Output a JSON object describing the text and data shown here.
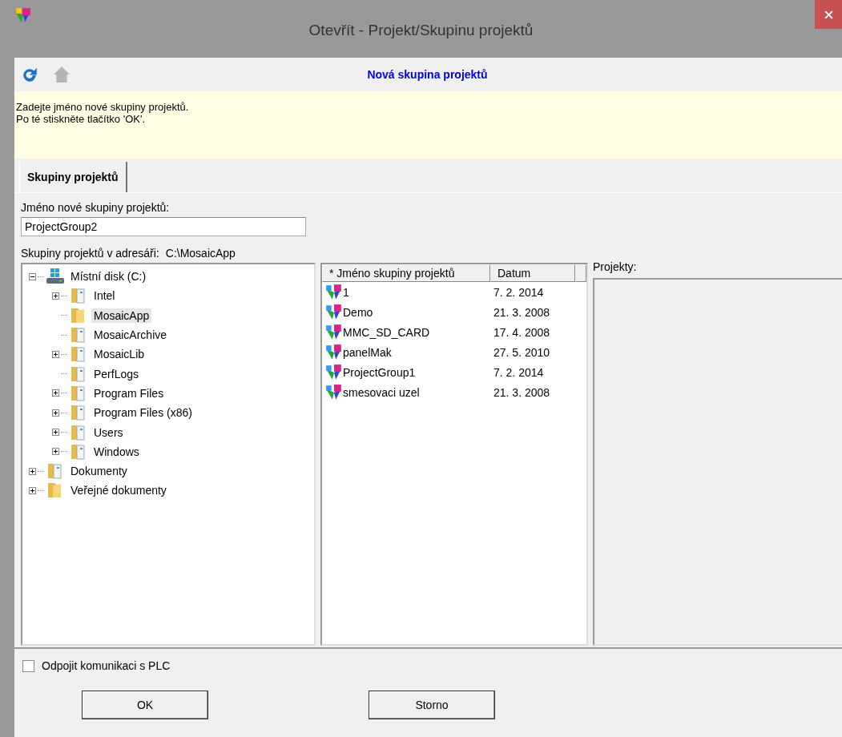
{
  "window": {
    "title": "Otevřít - Projekt/Skupinu projektů"
  },
  "toolbar": {
    "home_disabled": true,
    "heading": "Nová skupina projektů"
  },
  "hint": {
    "lines": [
      "Zadejte jméno nové skupiny projektů.",
      "Po té stiskněte tlačítko 'OK'."
    ]
  },
  "tabs": [
    {
      "label": "Skupiny projektů",
      "selected": true
    }
  ],
  "name_field": {
    "label": "Jméno nové skupiny projektů:",
    "value": "ProjectGroup2"
  },
  "directory": {
    "label": "Skupiny projektů v adresáři:",
    "path": "C:\\MosaicApp"
  },
  "tree": [
    {
      "label": "Místní disk (C:)",
      "kind": "drive",
      "expanded": true,
      "selected": false,
      "children": [
        {
          "label": "Intel",
          "kind": "folder-docs",
          "expanded": false,
          "selected": false
        },
        {
          "label": "MosaicApp",
          "kind": "folder",
          "selected": true
        },
        {
          "label": "MosaicArchive",
          "kind": "folder-docs",
          "selected": false
        },
        {
          "label": "MosaicLib",
          "kind": "folder-docs",
          "expanded": false,
          "selected": false
        },
        {
          "label": "PerfLogs",
          "kind": "folder-docs",
          "selected": false
        },
        {
          "label": "Program Files",
          "kind": "folder-docs",
          "expanded": false,
          "selected": false
        },
        {
          "label": "Program Files (x86)",
          "kind": "folder-docs",
          "expanded": false,
          "selected": false
        },
        {
          "label": "Users",
          "kind": "folder-docs",
          "expanded": false,
          "selected": false
        },
        {
          "label": "Windows",
          "kind": "folder-docs",
          "expanded": false,
          "selected": false
        }
      ]
    },
    {
      "label": "Dokumenty",
      "kind": "folder-docs",
      "expanded": false,
      "selected": false
    },
    {
      "label": "Veřejné dokumenty",
      "kind": "folder",
      "expanded": false,
      "selected": false
    }
  ],
  "groups": {
    "columns": [
      "* Jméno skupiny projektů",
      "Datum"
    ],
    "rows": [
      {
        "name": "1",
        "date": "7. 2. 2014"
      },
      {
        "name": "Demo",
        "date": "21. 3. 2008"
      },
      {
        "name": "MMC_SD_CARD",
        "date": "17. 4. 2008"
      },
      {
        "name": "panelMak",
        "date": "27. 5. 2010"
      },
      {
        "name": "ProjectGroup1",
        "date": "7. 2. 2014"
      },
      {
        "name": "smesovaci uzel",
        "date": "21. 3. 2008"
      }
    ]
  },
  "projects": {
    "label": "Projekty:"
  },
  "disconnect": {
    "label": "Odpojit komunikaci s PLC",
    "checked": false
  },
  "buttons": [
    "OK",
    "Storno"
  ]
}
